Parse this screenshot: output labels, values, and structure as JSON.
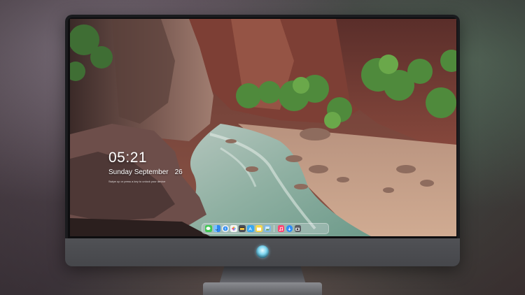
{
  "lock_screen": {
    "time": "05:21",
    "date_text": "Sunday September",
    "date_day": "26",
    "subtext": "Swipe up or press a key to unlock your device"
  },
  "dock": {
    "apps": [
      {
        "name": "messages-icon",
        "color": "#41c853"
      },
      {
        "name": "finder-icon",
        "color": "#2e86f0"
      },
      {
        "name": "safari-icon",
        "color": "#e8ecef"
      },
      {
        "name": "photos-icon",
        "color": "#f4f4f4"
      },
      {
        "name": "finalcut-icon",
        "color": "#4a4d57"
      },
      {
        "name": "appstore-icon",
        "color": "#39a8f0"
      },
      {
        "name": "notes-icon",
        "color": "#f6d64a"
      },
      {
        "name": "preview-icon",
        "color": "#7fb8e6"
      },
      {
        "name": "music-icon",
        "color": "#fb4673"
      },
      {
        "name": "downloads-icon",
        "color": "#2f8df5"
      },
      {
        "name": "camera-icon",
        "color": "#5a5c62"
      }
    ]
  }
}
